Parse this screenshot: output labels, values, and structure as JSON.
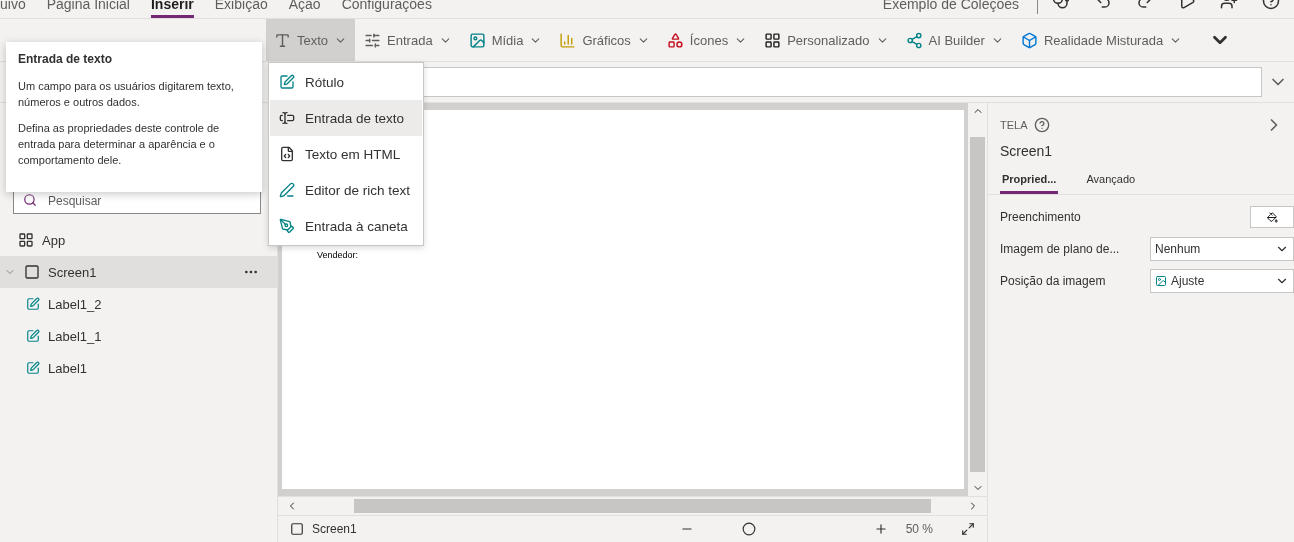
{
  "menu": [
    {
      "label": "uivo",
      "selected": false
    },
    {
      "label": "Página Inicial",
      "selected": false
    },
    {
      "label": "Inserir",
      "selected": true
    },
    {
      "label": "Exibição",
      "selected": false
    },
    {
      "label": "Ação",
      "selected": false
    },
    {
      "label": "Configurações",
      "selected": false
    }
  ],
  "app_title": "Exemplo de Coleções",
  "toolbar": [
    {
      "label": "Texto",
      "kind": "text",
      "selected": true
    },
    {
      "label": "Entrada",
      "kind": "input",
      "selected": false
    },
    {
      "label": "Mídia",
      "kind": "media",
      "selected": false
    },
    {
      "label": "Gráficos",
      "kind": "chart",
      "selected": false
    },
    {
      "label": "Ícones",
      "kind": "icons",
      "selected": false
    },
    {
      "label": "Personalizado",
      "kind": "custom",
      "selected": false
    },
    {
      "label": "AI Builder",
      "kind": "ai",
      "selected": false
    },
    {
      "label": "Realidade Misturada",
      "kind": "mixed",
      "selected": false
    }
  ],
  "tooltip": {
    "title": "Entrada de texto",
    "paragraphs": [
      "Um campo para os usuários digitarem texto, números e outros dados.",
      "Defina as propriedades deste controle de entrada para determinar a aparência e o comportamento dele."
    ]
  },
  "dropdown": [
    {
      "label": "Rótulo",
      "kind": "label",
      "selected": false
    },
    {
      "label": "Entrada de texto",
      "kind": "textinput",
      "selected": true
    },
    {
      "label": "Texto em HTML",
      "kind": "html",
      "selected": false
    },
    {
      "label": "Editor de rich text",
      "kind": "rich",
      "selected": false
    },
    {
      "label": "Entrada à caneta",
      "kind": "pen",
      "selected": false
    }
  ],
  "search": {
    "placeholder": "Pesquisar"
  },
  "tree": [
    {
      "label": "App",
      "kind": "app",
      "selected": false
    },
    {
      "label": "Screen1",
      "kind": "screen",
      "selected": true,
      "expanded": true,
      "children": [
        {
          "label": "Label1_2",
          "kind": "label",
          "selected": false
        },
        {
          "label": "Label1_1",
          "kind": "label",
          "selected": false
        },
        {
          "label": "Label1",
          "kind": "label",
          "selected": false
        }
      ]
    }
  ],
  "canvas": {
    "labels": [
      "Vendedor:"
    ]
  },
  "panel": {
    "type": "TELA",
    "name": "Screen1",
    "tabs": [
      {
        "label": "Propried...",
        "selected": true
      },
      {
        "label": "Avançado",
        "selected": false
      }
    ],
    "properties": [
      {
        "label": "Preenchimento",
        "kind": "color"
      },
      {
        "label": "Imagem de plano de...",
        "kind": "select",
        "value": "Nenhum"
      },
      {
        "label": "Posição da imagem",
        "kind": "image-select",
        "value": "Ajuste"
      }
    ]
  },
  "status": {
    "screen": "Screen1",
    "zoom": "50 %"
  }
}
